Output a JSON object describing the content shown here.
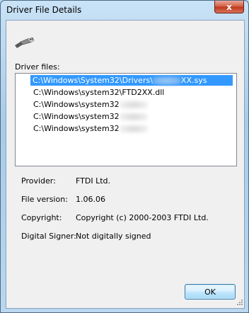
{
  "window": {
    "title": "Driver File Details",
    "close_glyph": "x"
  },
  "icons": {
    "device": "usb-connector-icon",
    "close": "close-icon",
    "grip": "size-grip-icon"
  },
  "driver_files": {
    "label": "Driver files:",
    "items": [
      {
        "prefix": "C:\\Windows\\System32\\Drivers\\",
        "suffix": "XX.sys",
        "redacted": true,
        "selected": true
      },
      {
        "prefix": "C:\\Windows\\system32\\FTD2XX.dll",
        "suffix": "",
        "redacted": false,
        "selected": false
      },
      {
        "prefix": "C:\\Windows\\system32",
        "suffix": "",
        "redacted": true,
        "selected": false
      },
      {
        "prefix": "C:\\Windows\\system32",
        "suffix": "",
        "redacted": true,
        "selected": false
      },
      {
        "prefix": "C:\\Windows\\system32",
        "suffix": "",
        "redacted": true,
        "selected": false
      }
    ]
  },
  "details": {
    "provider_label": "Provider:",
    "provider_value": "FTDI Ltd.",
    "version_label": "File version:",
    "version_value": "1.06.06",
    "copyright_label": "Copyright:",
    "copyright_value": "Copyright (c) 2000-2003 FTDI Ltd.",
    "signer_label": "Digital Signer:",
    "signer_value": "Not digitally signed"
  },
  "buttons": {
    "ok": "OK"
  },
  "colors": {
    "selection": "#3399ff",
    "frame": "#b9d7ef",
    "client": "#f0f0f0"
  }
}
